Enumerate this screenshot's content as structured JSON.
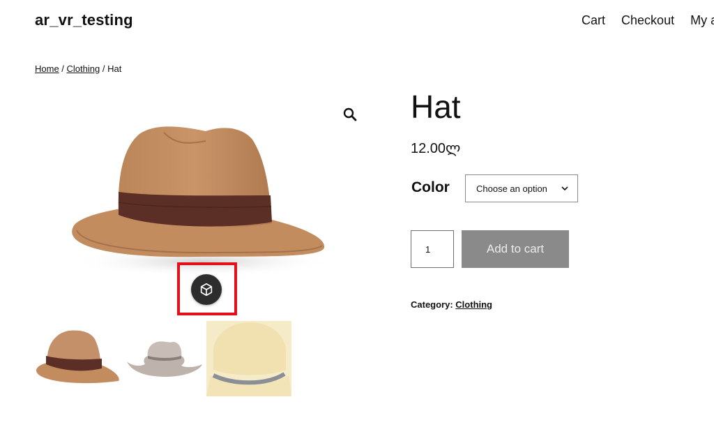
{
  "header": {
    "site_title": "ar_vr_testing",
    "nav": [
      "Cart",
      "Checkout",
      "My ac"
    ]
  },
  "breadcrumb": {
    "home": "Home",
    "sep1": " / ",
    "category": "Clothing",
    "sep2": " / ",
    "current": "Hat"
  },
  "product": {
    "title": "Hat",
    "price": "12.00ლ",
    "color_label": "Color",
    "color_select_value": "Choose an option",
    "quantity": "1",
    "add_to_cart_label": "Add to cart",
    "category_label": "Category: ",
    "category_value": "Clothing"
  },
  "icons": {
    "zoom": "magnifier-icon",
    "ar_view": "cube-icon",
    "select_chevron": "chevron-down-icon"
  },
  "colors": {
    "highlight_border": "#e3101a",
    "ar_button_bg": "#2d2d2d",
    "add_to_cart_bg": "#8a8a8a"
  }
}
